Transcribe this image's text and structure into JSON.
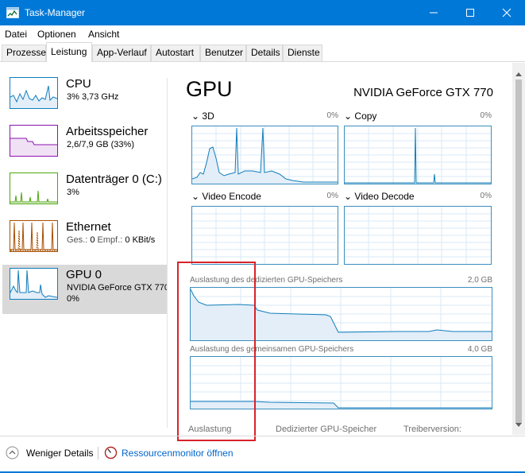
{
  "window": {
    "title": "Task-Manager",
    "accent": "#0078d7"
  },
  "menu": [
    "Datei",
    "Optionen",
    "Ansicht"
  ],
  "tabs": [
    "Prozesse",
    "Leistung",
    "App-Verlauf",
    "Autostart",
    "Benutzer",
    "Details",
    "Dienste"
  ],
  "active_tab": "Leistung",
  "sidebar": {
    "items": [
      {
        "name": "CPU",
        "sub": "3% 3,73 GHz",
        "color": "#117dbb",
        "icon": "cpu-graph"
      },
      {
        "name": "Arbeitsspeicher",
        "sub": "2,6/7,9 GB (33%)",
        "color": "#8b12ae",
        "icon": "memory-graph"
      },
      {
        "name": "Datenträger 0 (C:)",
        "sub": "3%",
        "color": "#4da60c",
        "icon": "disk-graph"
      },
      {
        "name": "Ethernet",
        "sub_parts": [
          "Ges.:",
          "0",
          "Empf.:",
          "0 KBit/s"
        ],
        "color": "#a74f01",
        "icon": "network-graph"
      },
      {
        "name": "GPU 0",
        "sub": "NVIDIA GeForce GTX 770",
        "sub2": "0%",
        "color": "#117dbb",
        "icon": "gpu-graph",
        "selected": true
      }
    ]
  },
  "main": {
    "title": "GPU",
    "gpu_name": "NVIDIA GeForce GTX 770",
    "engines": [
      {
        "label": "3D",
        "percent": "0%"
      },
      {
        "label": "Copy",
        "percent": "0%"
      },
      {
        "label": "Video Encode",
        "percent": "0%"
      },
      {
        "label": "Video Decode",
        "percent": "0%"
      }
    ],
    "dedicated_memory": {
      "label": "Auslastung des dedizierten GPU-Speichers",
      "max": "2,0 GB"
    },
    "shared_memory": {
      "label": "Auslastung des gemeinsamen GPU-Speichers",
      "max": "4,0 GB"
    },
    "stats": [
      "Auslastung",
      "Dedizierter GPU-Speicher",
      "Treiberversion:"
    ]
  },
  "footer": {
    "fewer_details": "Weniger Details",
    "resource_monitor": "Ressourcenmonitor öffnen"
  },
  "annotation": {
    "color": "#d8232a"
  }
}
